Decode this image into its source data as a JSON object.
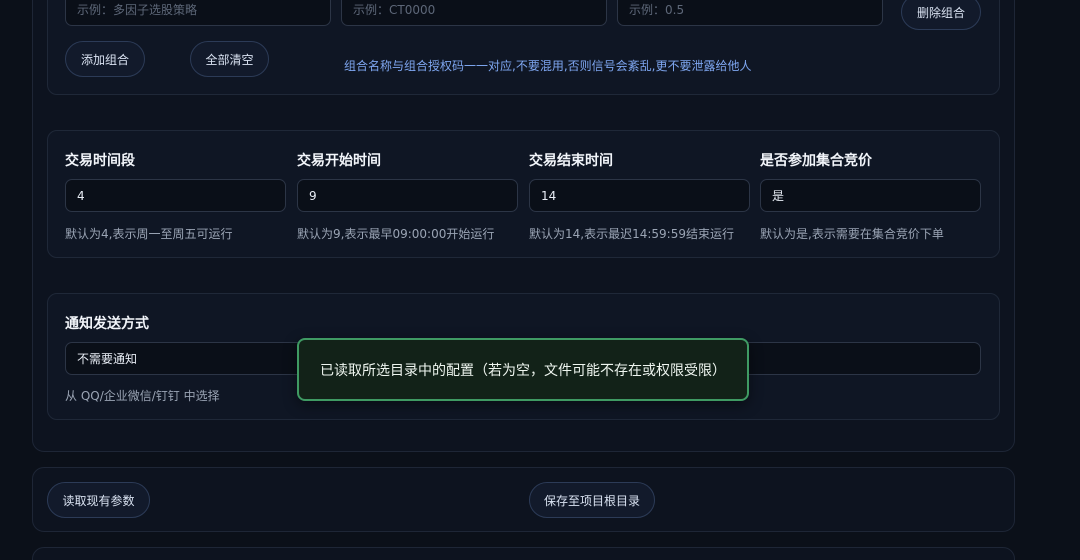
{
  "group": {
    "name_placeholder": "示例：多因子选股策略",
    "code_placeholder": "示例：CT0000",
    "weight_placeholder": "示例：0.5",
    "delete_label": "删除组合",
    "add_label": "添加组合",
    "clear_label": "全部清空",
    "note": "组合名称与组合授权码一一对应,不要混用,否则信号会紊乱,更不要泄露给他人"
  },
  "trading": {
    "fields": [
      {
        "title": "交易时间段",
        "value": "4",
        "hint": "默认为4,表示周一至周五可运行"
      },
      {
        "title": "交易开始时间",
        "value": "9",
        "hint": "默认为9,表示最早09:00:00开始运行"
      },
      {
        "title": "交易结束时间",
        "value": "14",
        "hint": "默认为14,表示最迟14:59:59结束运行"
      },
      {
        "title": "是否参加集合竞价",
        "value": "是",
        "hint": "默认为是,表示需要在集合竞价下单"
      }
    ]
  },
  "notify": {
    "title": "通知发送方式",
    "value": "不需要通知",
    "hint": "从 QQ/企业微信/钉钉 中选择"
  },
  "toast": {
    "message": "已读取所选目录中的配置（若为空，文件可能不存在或权限受限）"
  },
  "actions": {
    "read_label": "读取现有参数",
    "save_label": "保存至项目根目录"
  }
}
